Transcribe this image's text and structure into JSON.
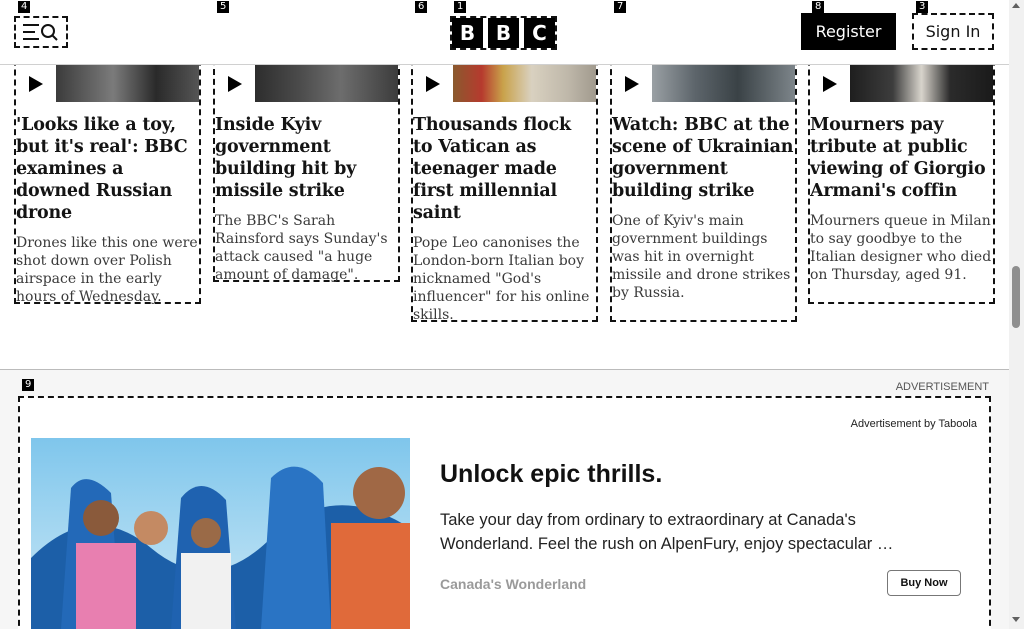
{
  "header": {
    "logo_letters": [
      "B",
      "B",
      "C"
    ],
    "register_label": "Register",
    "signin_label": "Sign In",
    "menu_icon": "menu-search-icon"
  },
  "markers": {
    "logo": "1",
    "signin": "3",
    "card1": "4",
    "card2": "5",
    "card3": "6",
    "card4": "7",
    "register": "8"
  },
  "cards": [
    {
      "title": "'Looks like a toy, but it's real': BBC examines a downed Russian drone",
      "summary": "Drones like this one were shot down over Polish airspace in the early hours of Wednesday."
    },
    {
      "title": "Inside Kyiv government building hit by missile strike",
      "summary": "The BBC's Sarah Rainsford says Sunday's attack caused \"a huge amount of damage\"."
    },
    {
      "title": "Thousands flock to Vatican as teenager made first millennial saint",
      "summary": "Pope Leo canonises the London-born Italian boy nicknamed \"God's influencer\" for his online skills."
    },
    {
      "title": "Watch: BBC at the scene of Ukrainian government building strike",
      "summary": "One of Kyiv's main government buildings was hit in overnight missile and drone strikes by Russia."
    },
    {
      "title": "Mourners pay tribute at public viewing of Giorgio Armani's coffin",
      "summary": "Mourners queue in Milan to say goodbye to the Italian designer who died on Thursday, aged 91."
    }
  ],
  "ad": {
    "marker": "9",
    "section_label": "ADVERTISEMENT",
    "provider": "Advertisement by Taboola",
    "headline": "Unlock epic thrills.",
    "description": "Take your day from ordinary to extraordinary at Canada's Wonderland. Feel the rush on AlpenFury, enjoy spectacular …",
    "brand": "Canada's Wonderland",
    "cta": "Buy Now"
  },
  "colors": {
    "brand_black": "#000000",
    "ad_background": "#f6f6f6"
  }
}
